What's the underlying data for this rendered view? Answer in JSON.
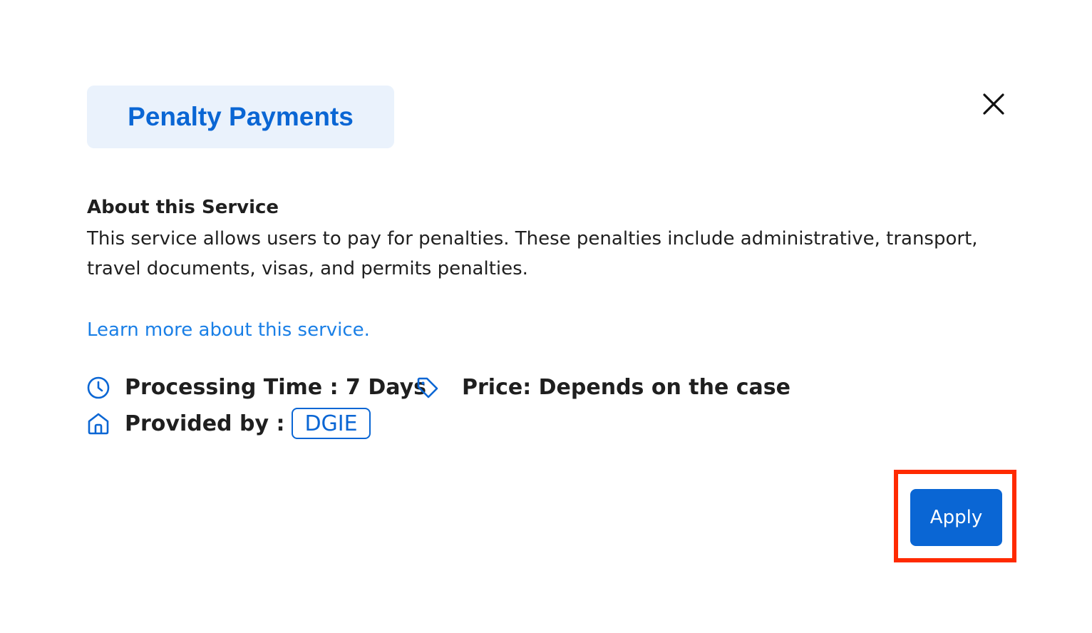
{
  "dialog": {
    "title": "Penalty Payments",
    "close_icon": "close-icon"
  },
  "about": {
    "heading": "About this Service",
    "description": "This service allows users to pay for penalties. These penalties include administrative, transport, travel documents, visas, and permits penalties.",
    "learn_more": "Learn more about this service."
  },
  "details": {
    "processing_time": "Processing Time : 7 Days",
    "processing_icon": "clock-icon",
    "price": "Price: Depends on the case",
    "price_icon": "tag-icon",
    "provided_by_label": "Provided by :",
    "provided_by_icon": "home-icon",
    "provider": "DGIE"
  },
  "actions": {
    "apply_label": "Apply"
  },
  "colors": {
    "accent": "#0a66d4",
    "link": "#1a7fe6",
    "title_chip_bg": "#eaf2fc",
    "highlight": "#ff2a00"
  }
}
